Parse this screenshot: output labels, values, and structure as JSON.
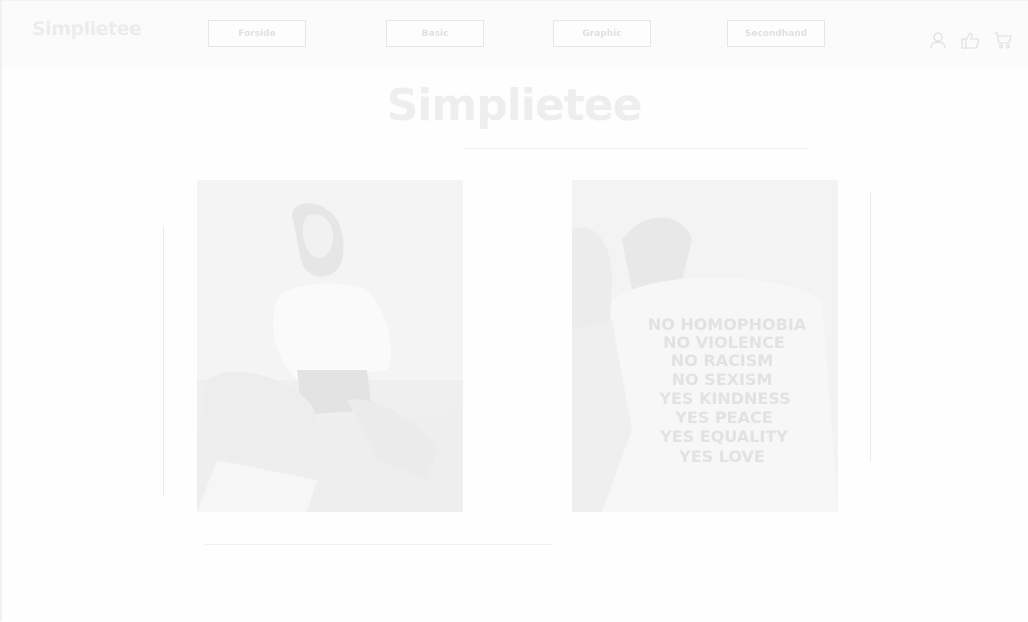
{
  "brand": {
    "logo_text": "Simplietee",
    "hero_title": "Simplietee"
  },
  "nav": [
    {
      "label": "Forside"
    },
    {
      "label": "Basic"
    },
    {
      "label": "Graphic"
    },
    {
      "label": "Secondhand"
    }
  ],
  "header_icons": [
    "user-icon",
    "like-icon",
    "cart-icon"
  ],
  "products": [
    {
      "image": "woman-laughing-beach-photo"
    },
    {
      "image": "slogan-tshirt-back-photo",
      "shirt_text": [
        "NO HOMOPHOBIA",
        "NO VIOLENCE",
        "NO RACISM",
        "NO SEXISM",
        "YES KINDNESS",
        "YES PEACE",
        "YES EQUALITY",
        "YES LOVE"
      ]
    }
  ]
}
